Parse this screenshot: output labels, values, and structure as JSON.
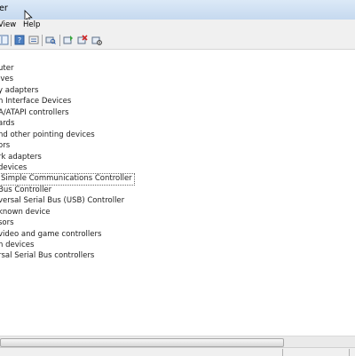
{
  "window": {
    "title": "er"
  },
  "menu": {
    "items": [
      "View",
      "Help"
    ]
  },
  "tree": {
    "items": [
      "uter",
      "ives",
      "y adapters",
      "n Interface Devices",
      "A/ATAPI controllers",
      "ards",
      "nd other pointing devices",
      "ors",
      "rk adapters",
      "devices",
      "Simple Communications Controller",
      "Bus Controller",
      "versal Serial Bus (USB) Controller",
      "known device",
      "sors",
      " video and game controllers",
      "n devices",
      "rsal Serial Bus controllers"
    ],
    "selected_index": 10
  }
}
